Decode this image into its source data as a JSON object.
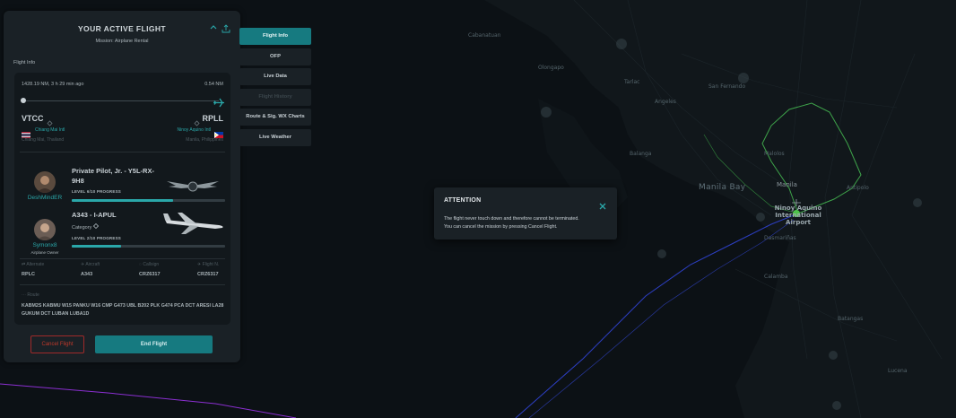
{
  "map": {
    "labels": {
      "bay": "Manila Bay",
      "airport": "Ninoy Aquino International Airport",
      "manila": "Manila",
      "cities": [
        "Cabanatuan",
        "Tarlac",
        "San Fernando",
        "Angeles",
        "Balanga",
        "Malolos",
        "Antipolo",
        "Dasmariñas",
        "Calamba",
        "Batangas",
        "Lucena",
        "Olongapo"
      ]
    },
    "colors": {
      "route_green": "#3ea34a",
      "route_blue": "#2d3fc4",
      "route_purple": "#8b2fd1",
      "airport_marker": "#4ec24a"
    }
  },
  "panel": {
    "title": "YOUR ACTIVE FLIGHT",
    "subtitle": "Mission: Airplane Rental",
    "section": "Flight Info",
    "distance_left": "1428.19 NM, 3 h 29 min ago",
    "distance_right": "0.54 NM",
    "departure": {
      "icao": "VTCC",
      "name": "Chiang Mai Intl",
      "location": "Chiang Mai, Thailand"
    },
    "arrival": {
      "icao": "RPLL",
      "name": "Ninoy Aquino Intl",
      "location": "Manila, Philippines"
    },
    "pilot": {
      "username": "DeshMindER",
      "license": "Private Pilot, Jr. - Y5L-RX-9H8",
      "level": "LEVEL 6/10 PROGRESS",
      "progress": 0.66
    },
    "aircraft": {
      "owner_name": "Symonx8",
      "owner_role": "Airplane Owner",
      "title": "A343 - I-APUL",
      "category_label": "Category",
      "level": "LEVEL 2/10 PROGRESS",
      "progress": 0.32
    },
    "fields": [
      {
        "label": "Alternate",
        "value": "RPLC"
      },
      {
        "label": "Aircraft",
        "value": "A343"
      },
      {
        "label": "Callsign",
        "value": "CRZ6317"
      },
      {
        "label": "Flight N.",
        "value": "CRZ6317"
      }
    ],
    "route_label": "Route",
    "route_value": "KABM2S KABMU W15 PANKU W16 CMP G473 UBL B202 PLK G474 PCA DCT ARESI LA28 GUKUM DCT LUBAN LUBA1D",
    "cancel_label": "Cancel Flight",
    "end_label": "End Flight"
  },
  "tabs": [
    {
      "label": "Flight Info",
      "state": "active"
    },
    {
      "label": "OFP",
      "state": "normal"
    },
    {
      "label": "Live Data",
      "state": "normal"
    },
    {
      "label": "Flight History",
      "state": "disabled"
    },
    {
      "label": "Route & Sig. WX Charts",
      "state": "normal"
    },
    {
      "label": "Live Weather",
      "state": "normal"
    }
  ],
  "dialog": {
    "title": "ATTENTION",
    "line1": "The flight never touch down and therefore cannot be terminated.",
    "line2": "You can cancel the mission by pressing Cancel Flight."
  }
}
